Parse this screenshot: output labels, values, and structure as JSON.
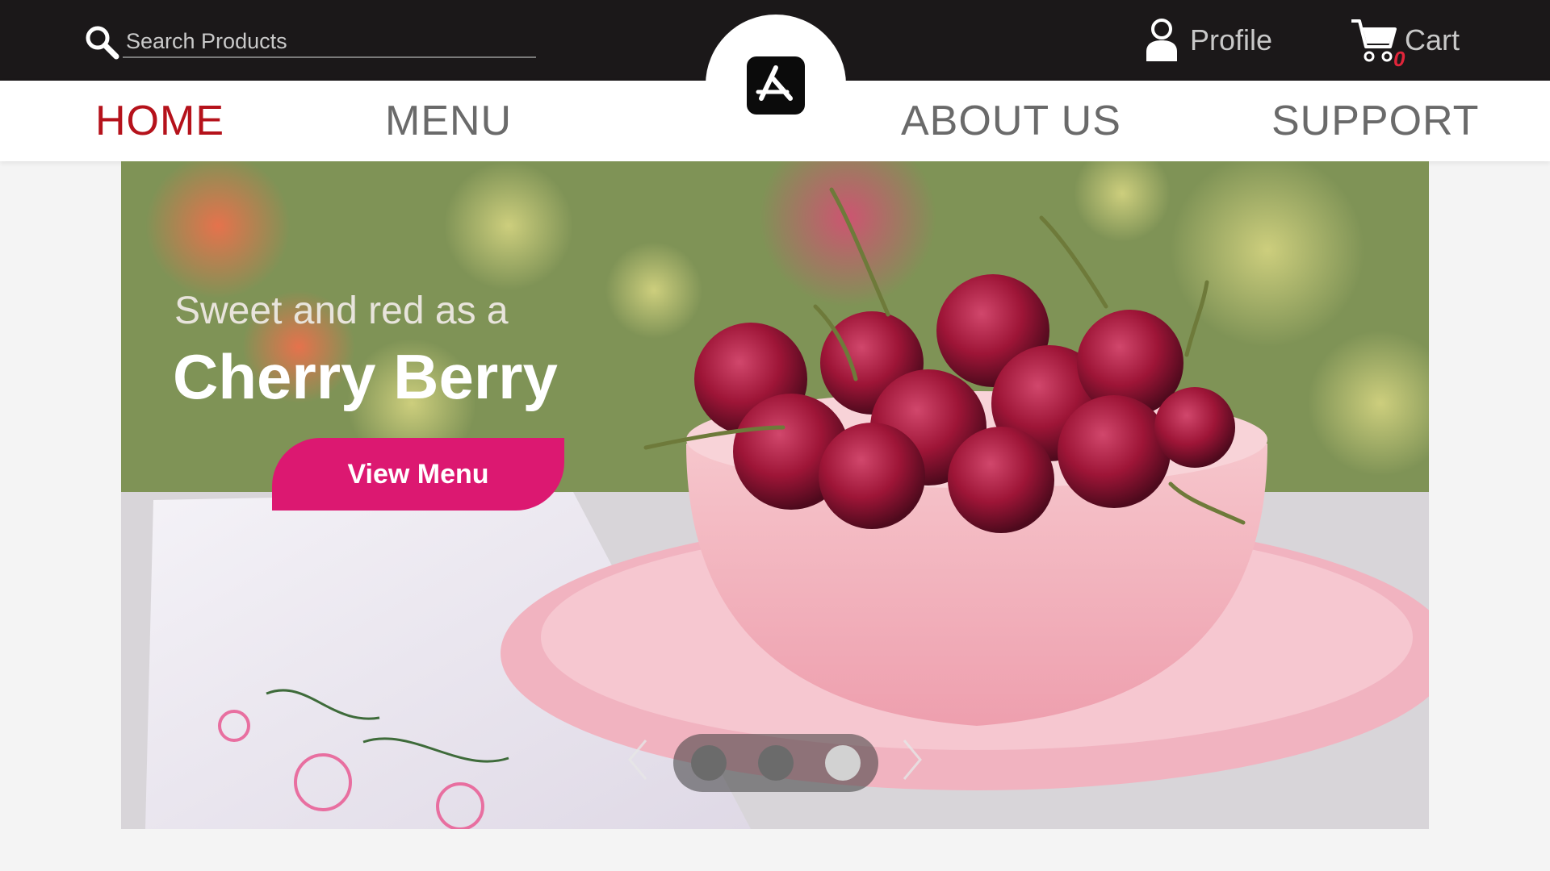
{
  "header": {
    "search": {
      "placeholder": "Search Products",
      "value": ""
    },
    "profile_label": "Profile",
    "cart_label": "Cart",
    "cart_count": "0"
  },
  "nav": {
    "items": [
      {
        "label": "HOME",
        "active": true
      },
      {
        "label": "MENU",
        "active": false
      },
      {
        "label": "ABOUT US",
        "active": false
      },
      {
        "label": "SUPPORT",
        "active": false
      }
    ],
    "logo_icon": "app-store-icon"
  },
  "hero": {
    "subtitle": "Sweet and red as a",
    "title": "Cherry Berry",
    "cta_label": "View Menu",
    "carousel": {
      "slide_count": 3,
      "active_index": 2
    }
  },
  "colors": {
    "topbar": "#1b1819",
    "active_nav": "#b5121b",
    "cta": "#dc1871",
    "nav_text": "#6a6a6a"
  }
}
